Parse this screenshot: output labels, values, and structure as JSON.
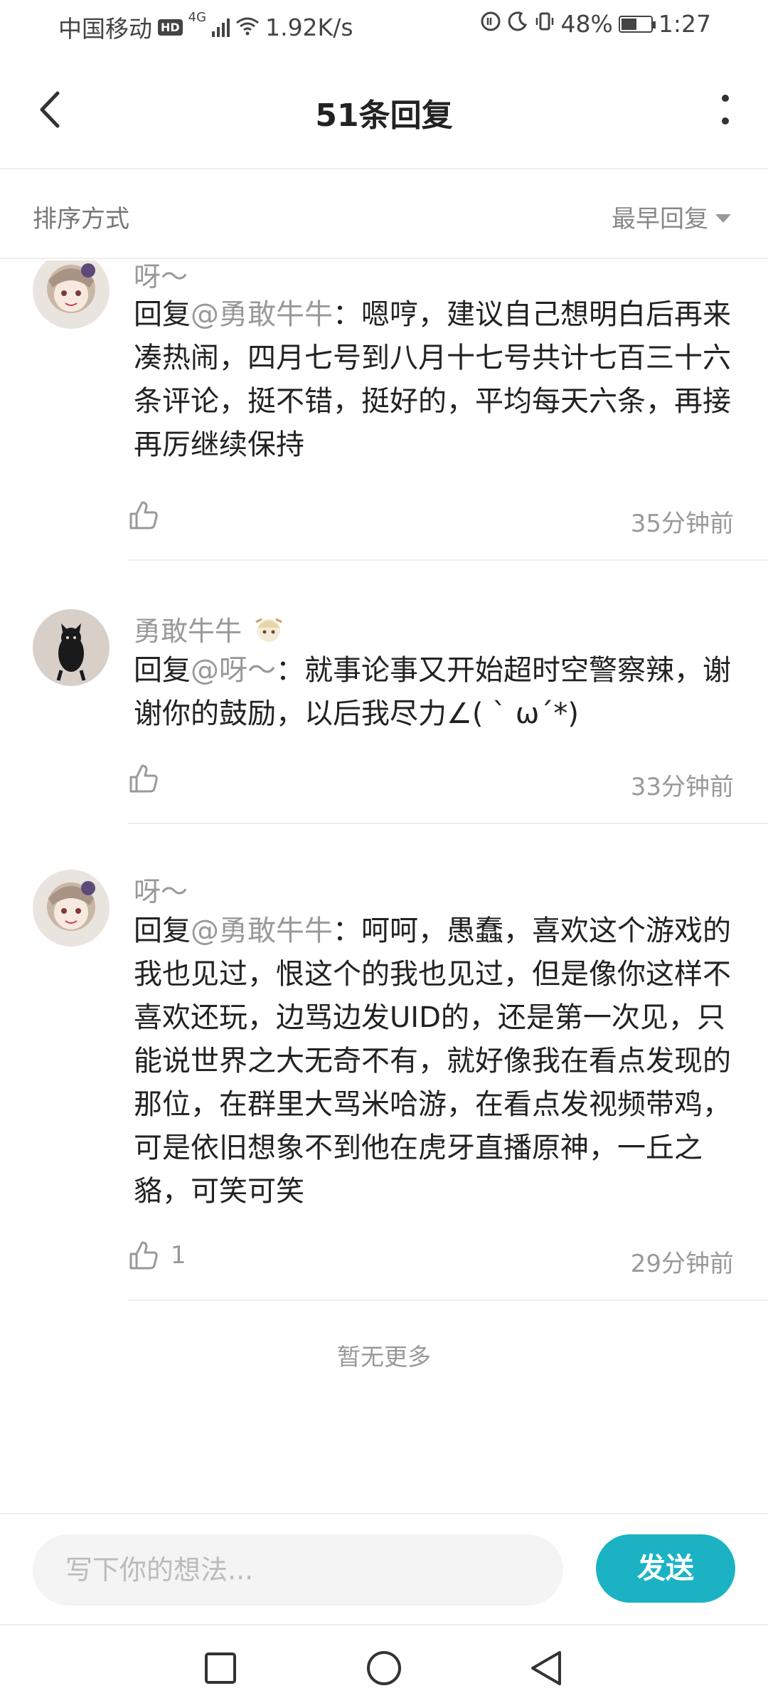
{
  "status_bar": {
    "carrier": "中国移动",
    "hd": "HD",
    "network": "4G",
    "speed": "1.92K/s",
    "battery": "48%",
    "time": "1:27"
  },
  "header": {
    "title": "51条回复"
  },
  "sort": {
    "label": "排序方式",
    "selected": "最早回复"
  },
  "comments": [
    {
      "username": "呀～",
      "reply_prefix": "回复",
      "mention": "@勇敢牛牛",
      "text": "：嗯哼，建议自己想明白后再来凑热闹，四月七号到八月十七号共计七百三十六条评论，挺不错，挺好的，平均每天六条，再接再厉继续保持",
      "likes": "",
      "time": "35分钟前"
    },
    {
      "username": "勇敢牛牛",
      "reply_prefix": "回复",
      "mention": "@呀～",
      "text": "：就事论事又开始超时空警察辣，谢谢你的鼓励，以后我尽力∠( ˋ ωˊ*)",
      "likes": "",
      "time": "33分钟前"
    },
    {
      "username": "呀～",
      "reply_prefix": "回复",
      "mention": "@勇敢牛牛",
      "text": "：呵呵，愚蠢，喜欢这个游戏的我也见过，恨这个的我也见过，但是像你这样不喜欢还玩，边骂边发UID的，还是第一次见，只能说世界之大无奇不有，就好像我在看点发现的那位，在群里大骂米哈游，在看点发视频带鸡，可是依旧想象不到他在虎牙直播原神，一丘之貉，可笑可笑",
      "likes": "1",
      "time": "29分钟前"
    }
  ],
  "footer": {
    "no_more": "暂无更多"
  },
  "composer": {
    "placeholder": "写下你的想法...",
    "send_label": "发送"
  },
  "colors": {
    "accent": "#1bb3c4",
    "muted_text": "#999999",
    "divider": "#eeeeee"
  }
}
